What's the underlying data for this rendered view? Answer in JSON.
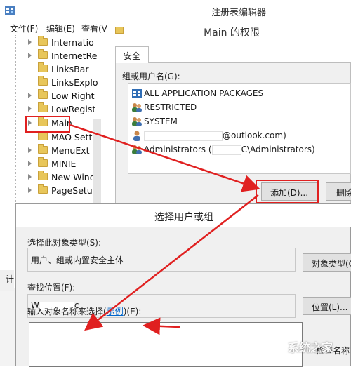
{
  "registry_editor": {
    "title": "注册表编辑器",
    "menu": [
      "文件(F)",
      "编辑(E)",
      "查看(V"
    ],
    "tree_items": [
      "Internatio",
      "InternetRe",
      "LinksBar",
      "LinksExplo",
      "Low Right",
      "LowRegist",
      "Main",
      "MAO Setti",
      "MenuExt",
      "MINIE",
      "New Wind",
      "PageSetup"
    ],
    "status_left": "计"
  },
  "permissions_dialog": {
    "title": "Main 的权限",
    "tab": "安全",
    "group_label": "组或用户名(G):",
    "users": [
      {
        "text": "ALL APPLICATION PACKAGES",
        "icon": "app-packages-icon"
      },
      {
        "text": "RESTRICTED",
        "icon": "user-group-icon"
      },
      {
        "text": "SYSTEM",
        "icon": "user-group-icon"
      },
      {
        "text": "@outlook.com)",
        "icon": "user-icon"
      },
      {
        "text": "Administrators (",
        "suffix": "C\\Administrators)",
        "icon": "user-group-icon"
      }
    ],
    "add_button": "添加(D)...",
    "remove_button": "删除"
  },
  "select_dialog": {
    "title": "选择用户或组",
    "object_type_label": "选择此对象类型(S):",
    "object_type_value": "用户、组或内置安全主体",
    "object_type_button": "对象类型(O",
    "location_label": "查找位置(F):",
    "location_value": "W",
    "location_suffix": "c",
    "location_button": "位置(L)...",
    "name_label_prefix": "输入对象名称来选择(",
    "name_label_link": "示例",
    "name_label_suffix": ")(E):",
    "check_names_button": "检查名称"
  },
  "watermark": "系统之家",
  "colors": {
    "highlight": "#e02020",
    "arrow": "#e02020"
  }
}
